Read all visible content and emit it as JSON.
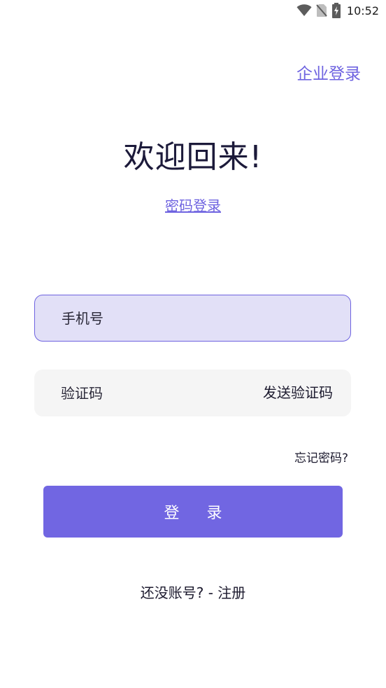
{
  "status_bar": {
    "time": "10:52",
    "icons": [
      "wifi-icon",
      "no-sim-icon",
      "battery-charging-icon"
    ]
  },
  "header": {
    "enterprise_login": "企业登录"
  },
  "welcome": {
    "title": "欢迎回来!",
    "password_login_link": "密码登录"
  },
  "form": {
    "phone_placeholder": "手机号",
    "phone_value": "",
    "code_placeholder": "验证码",
    "code_value": "",
    "send_code_label": "发送验证码",
    "forgot_password": "忘记密码?",
    "login_button": "登 录",
    "register_prompt": "还没账号? - 注册"
  },
  "colors": {
    "accent": "#6e63e0",
    "button": "#7166e2",
    "phone_field_bg": "#e2e0f7",
    "code_field_bg": "#f5f5f5"
  }
}
